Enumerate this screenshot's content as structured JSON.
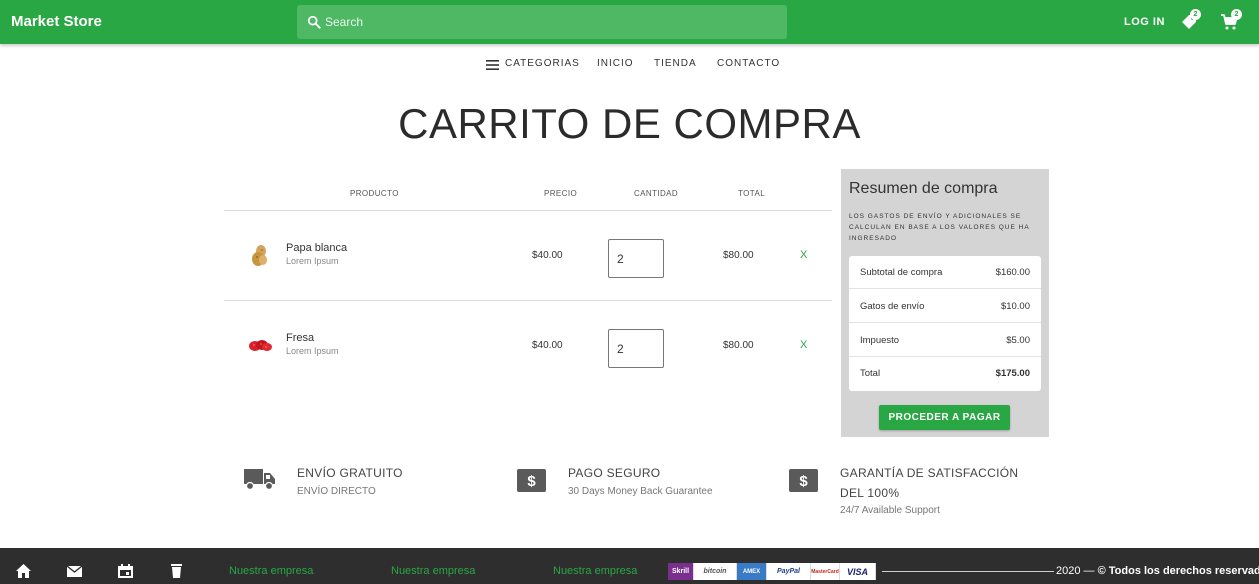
{
  "header": {
    "brand": "Market Store",
    "search_placeholder": "Search",
    "login": "LOG IN",
    "wishlist_count": "2",
    "cart_count": "2",
    "accent": "#29a744"
  },
  "nav": {
    "items": [
      "CATEGORIAS",
      "INICIO",
      "TIENDA",
      "CONTACTO"
    ]
  },
  "page_title": "CARRITO DE COMPRA",
  "cart": {
    "columns": [
      "PRODUCTO",
      "PRECIO",
      "CANTIDAD",
      "TOTAL"
    ],
    "items": [
      {
        "name": "Papa blanca",
        "subtitle": "Lorem Ipsum",
        "price": "$40.00",
        "quantity": "2",
        "total": "$80.00",
        "remove": "X",
        "icon": "potato-image"
      },
      {
        "name": "Fresa",
        "subtitle": "Lorem Ipsum",
        "price": "$40.00",
        "quantity": "2",
        "total": "$80.00",
        "remove": "X",
        "icon": "strawberry-image"
      }
    ]
  },
  "summary": {
    "title": "Resumen de compra",
    "note": "LOS GASTOS DE ENVÍO Y ADICIONALES SE CALCULAN EN BASE A LOS VALORES QUE HA INGRESADO",
    "rows": [
      {
        "label": "Subtotal de compra",
        "value": "$160.00"
      },
      {
        "label": "Gatos de envío",
        "value": "$10.00"
      },
      {
        "label": "Impuesto",
        "value": "$5.00"
      },
      {
        "label": "Total",
        "value": "$175.00"
      }
    ],
    "button": "PROCEDER A PAGAR"
  },
  "features": [
    {
      "title": "ENVÍO GRATUITO",
      "subtitle": "ENVÍO DIRECTO",
      "icon": "truck-icon"
    },
    {
      "title": "PAGO SEGURO",
      "subtitle": "30 Days Money Back Guarantee",
      "icon": "money-icon"
    },
    {
      "title_line1": "GARANTÍA DE SATISFACCIÓN",
      "title_line2": "DEL 100%",
      "subtitle": "24/7 Available Support",
      "icon": "money-icon"
    }
  ],
  "footer": {
    "icons": [
      "home-icon",
      "mail-icon",
      "calendar-icon",
      "trash-icon"
    ],
    "links": [
      "Nuestra empresa",
      "Nuestra empresa",
      "Nuestra empresa"
    ],
    "payments": [
      "Skrill",
      "bitcoin",
      "AMEX",
      "PayPal",
      "MasterCard",
      "VISA"
    ],
    "copyright_year": "2020 —",
    "copyright_text": "© Todos los derechos reservados"
  }
}
